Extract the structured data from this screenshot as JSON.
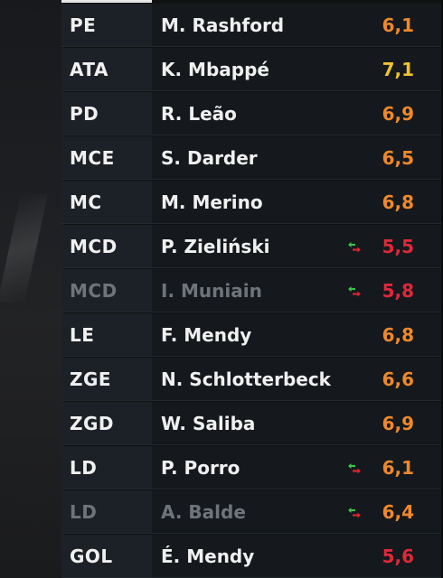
{
  "colors": {
    "rating_orange": "#f0882a",
    "rating_yellow": "#f2c12e",
    "rating_red": "#e0283a",
    "sub_green": "#3fbf4a",
    "sub_red": "#d8262f"
  },
  "players": [
    {
      "pos": "PE",
      "name": "M. Rashford",
      "rating": "6,1",
      "rating_color": "#f0882a",
      "sub": false,
      "state": "active"
    },
    {
      "pos": "ATA",
      "name": "K. Mbappé",
      "rating": "7,1",
      "rating_color": "#f2c12e",
      "sub": false,
      "state": "active"
    },
    {
      "pos": "PD",
      "name": "R. Leão",
      "rating": "6,9",
      "rating_color": "#f0882a",
      "sub": false,
      "state": "active"
    },
    {
      "pos": "MCE",
      "name": "S. Darder",
      "rating": "6,5",
      "rating_color": "#f0882a",
      "sub": false,
      "state": "active"
    },
    {
      "pos": "MC",
      "name": "M. Merino",
      "rating": "6,8",
      "rating_color": "#f0882a",
      "sub": false,
      "state": "active"
    },
    {
      "pos": "MCD",
      "name": "P. Zieliński",
      "rating": "5,5",
      "rating_color": "#e0283a",
      "sub": true,
      "state": "active"
    },
    {
      "pos": "MCD",
      "name": "I. Muniain",
      "rating": "5,8",
      "rating_color": "#e0283a",
      "sub": true,
      "state": "bench"
    },
    {
      "pos": "LE",
      "name": "F. Mendy",
      "rating": "6,8",
      "rating_color": "#f0882a",
      "sub": false,
      "state": "active"
    },
    {
      "pos": "ZGE",
      "name": "N. Schlotterbeck",
      "rating": "6,6",
      "rating_color": "#f0882a",
      "sub": false,
      "state": "active"
    },
    {
      "pos": "ZGD",
      "name": "W. Saliba",
      "rating": "6,9",
      "rating_color": "#f0882a",
      "sub": false,
      "state": "active"
    },
    {
      "pos": "LD",
      "name": "P. Porro",
      "rating": "6,1",
      "rating_color": "#f0882a",
      "sub": true,
      "state": "active"
    },
    {
      "pos": "LD",
      "name": "A. Balde",
      "rating": "6,4",
      "rating_color": "#f0882a",
      "sub": true,
      "state": "bench"
    },
    {
      "pos": "GOL",
      "name": "É. Mendy",
      "rating": "5,6",
      "rating_color": "#e0283a",
      "sub": false,
      "state": "active"
    }
  ],
  "icons": {
    "substitution": "substitution-icon"
  }
}
